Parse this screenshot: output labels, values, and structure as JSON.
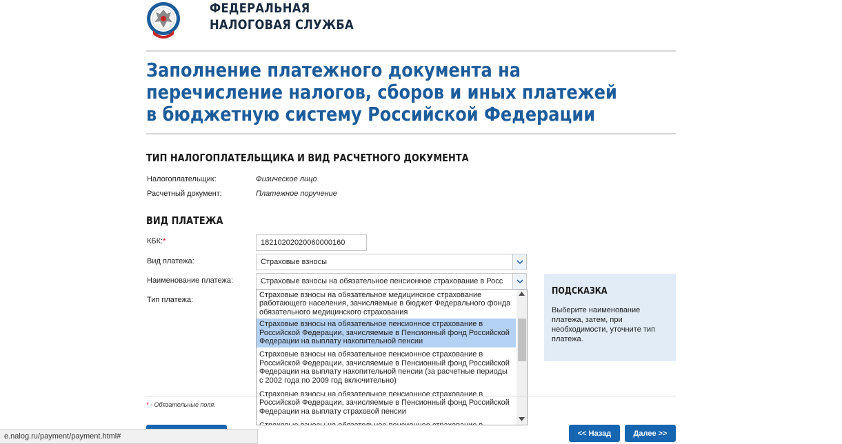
{
  "header": {
    "org_line1": "ФЕДЕРАЛЬНАЯ",
    "org_line2": "НАЛОГОВАЯ СЛУЖБА"
  },
  "page": {
    "title": "Заполнение платежного документа на перечисление налогов, сборов и иных платежей в бюджетную систему Российской Федерации"
  },
  "taxpayer_section": {
    "heading": "ТИП НАЛОГОПЛАТЕЛЬЩИКА И ВИД РАСЧЕТНОГО ДОКУМЕНТА",
    "payer_label": "Налогоплательщик:",
    "payer_value": "Физическое лицо",
    "doc_label": "Расчетный документ:",
    "doc_value": "Платежное поручение"
  },
  "payment_section": {
    "heading": "ВИД ПЛАТЕЖА",
    "kbk_label": "КБК:",
    "required_mark": "*",
    "kbk_value": "18210202020060000160",
    "type_label": "Вид платежа:",
    "type_value": "Страховые взносы",
    "name_label": "Наименование платежа:",
    "name_value": "Страховые взносы на обязательное пенсионное страхование в Росс",
    "kind_label": "Тип платежа:"
  },
  "dropdown_options": [
    {
      "text": "Страховые взносы на обязательное медицинское страхование работающего населения, зачисляемые в бюджет Федерального фонда обязательного медицинского страхования",
      "selected": false
    },
    {
      "text": "Страховые взносы на обязательное пенсионное страхование в Российской Федерации, зачисляемые в Пенсионный фонд Российской Федерации на выплату накопительной пенсии",
      "selected": true
    },
    {
      "text": "Страховые взносы на обязательное пенсионное страхование в Российской Федерации, зачисляемые в Пенсионный фонд Российской Федерации на выплату накопительной пенсии (за расчетные периоды с 2002 года по 2009 год включительно)",
      "selected": false
    },
    {
      "text": "Страховые взносы на обязательное пенсионное страхование в Российской Федерации, зачисляемые в Пенсионный фонд Российской Федерации на выплату страховой пенсии",
      "selected": false
    },
    {
      "text": "Страховые взносы на обязательное пенсионное страхование в Российской Федерации, зачисляемые в Пенсионный фонд Российской Федерации на выплату страховой пенсии (за расчетные периоды",
      "selected": false
    }
  ],
  "hint": {
    "title": "ПОДСКАЗКА",
    "text": "Выберите наименование платежа, затем, при необходимости, уточните тип платежа."
  },
  "footer": {
    "required_note": "- Обязательные поля.",
    "back_button": "<< Назад",
    "next_button": "Далее >>"
  },
  "status_bar": {
    "url": "e.nalog.ru/payment/payment.html#"
  },
  "colors": {
    "brand_blue": "#1d5c9a",
    "button_blue": "#1565b0",
    "selected_option": "#b3d1f2",
    "hint_bg": "#e1ecf7",
    "required_red": "#d0021b"
  }
}
